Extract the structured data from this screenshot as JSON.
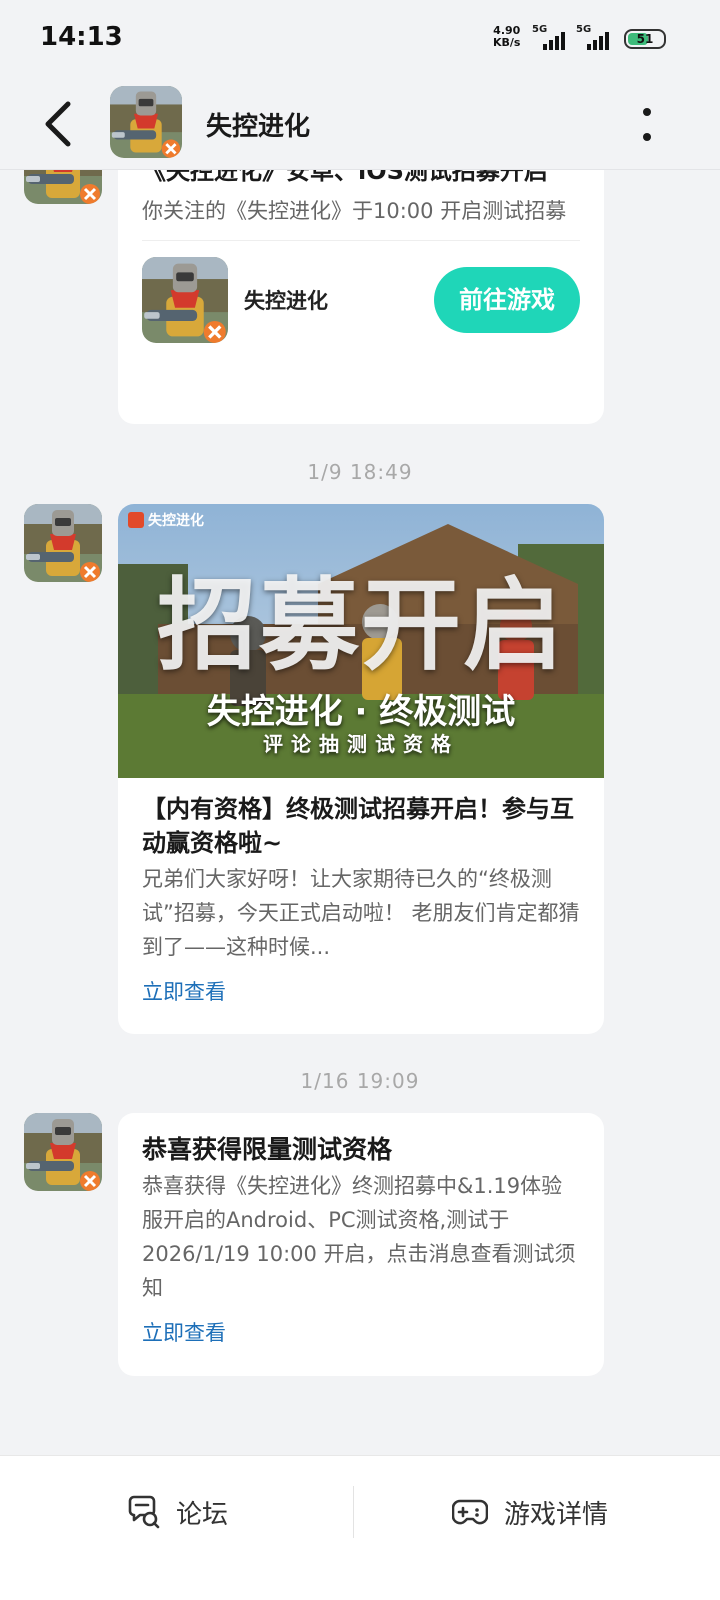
{
  "status_bar": {
    "time": "14:13",
    "net_speed_value": "4.90",
    "net_speed_unit": "KB/s",
    "signal1_label": "5G",
    "signal2_label": "5G",
    "battery": "51"
  },
  "header": {
    "title": "失控进化"
  },
  "messages": [
    {
      "title": "《失控进化》安卓、iOS测试招募开启",
      "body": "你关注的《失控进化》于10:00 开启测试招募",
      "game_name": "失控进化",
      "button_label": "前往游戏"
    },
    {
      "timestamp": "1/9  18:49",
      "banner_logo": "失控进化",
      "banner_headline": "招募开启",
      "banner_subtitle": "失控进化 · 终极测试",
      "banner_tagline": "评论抽测试资格",
      "title": "【内有资格】终极测试招募开启！参与互动赢资格啦~",
      "body": "兄弟们大家好呀！让大家期待已久的“终极测试”招募，今天正式启动啦！ 老朋友们肯定都猜到了——这种时候...",
      "link_label": "立即查看"
    },
    {
      "timestamp": "1/16  19:09",
      "title": "恭喜获得限量测试资格",
      "body": "恭喜获得《失控进化》终测招募中&1.19体验服开启的Android、PC测试资格,测试于2026/1/19 10:00 开启，点击消息查看测试须知",
      "link_label": "立即查看"
    }
  ],
  "bottom_nav": {
    "forum_label": "论坛",
    "game_details_label": "游戏详情"
  },
  "colors": {
    "accent": "#1fd6b8",
    "link": "#1d6fb8",
    "background": "#f2f3f5"
  }
}
